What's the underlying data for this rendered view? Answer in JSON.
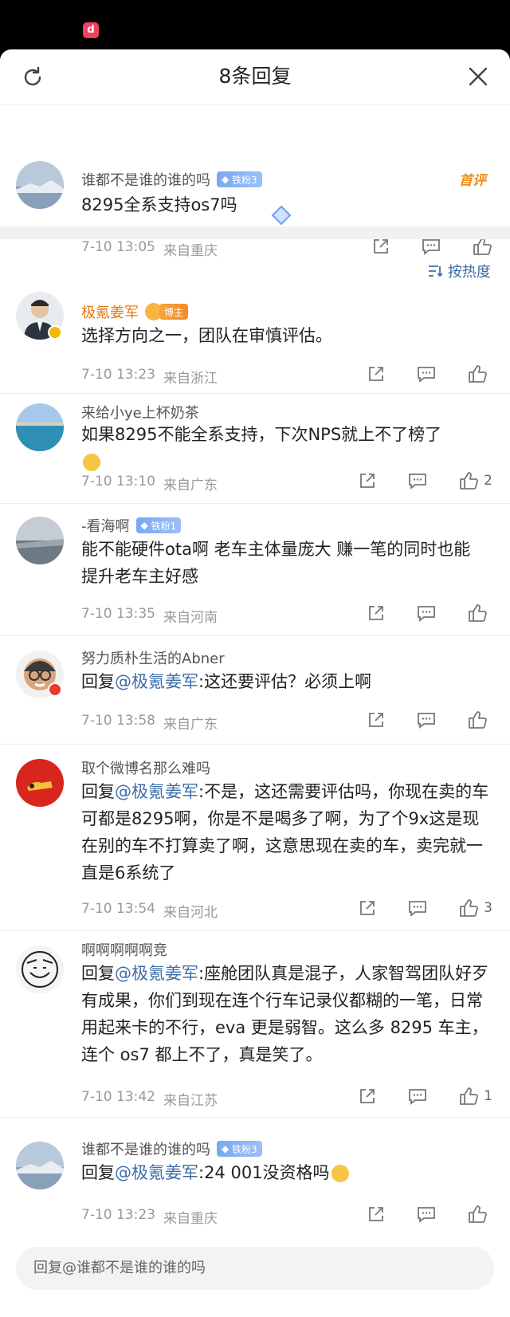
{
  "header": {
    "title": "8条回复"
  },
  "root": {
    "user": "谁都不是谁的谁的吗",
    "badge": "铁粉3",
    "text": "8295全系支持os7吗",
    "time": "7-10 13:05",
    "location": "来自重庆",
    "first_label": "首评"
  },
  "sort": {
    "label": "按热度"
  },
  "replies": [
    {
      "user": "极氪姜军",
      "badge": "博主",
      "text": "选择方向之一，团队在审慎评估。",
      "time": "7-10 13:23",
      "location": "来自浙江",
      "likes": ""
    },
    {
      "user": "来给小ye上杯奶茶",
      "text": "如果8295不能全系支持，下次NPS就上不了榜了",
      "time": "7-10 13:10",
      "location": "来自广东",
      "likes": "2"
    },
    {
      "user": "-看海啊",
      "badge": "铁粉1",
      "text": "能不能硬件ota啊 老车主体量庞大 赚一笔的同时也能提升老车主好感",
      "time": "7-10 13:35",
      "location": "来自河南",
      "likes": ""
    },
    {
      "user": "努力质朴生活的Abner",
      "prefix": "回复",
      "mention": "@极氪姜军",
      "text": ":这还要评估？必须上啊",
      "time": "7-10 13:58",
      "location": "来自广东",
      "likes": ""
    },
    {
      "user": "取个微博名那么难吗",
      "prefix": "回复",
      "mention": "@极氪姜军",
      "text": ":不是，这还需要评估吗，你现在卖的车可都是8295啊，你是不是喝多了啊，为了个9x这是现在别的车不打算卖了啊，这意思现在卖的车，卖完就一直是6系统了",
      "time": "7-10 13:54",
      "location": "来自河北",
      "likes": "3"
    },
    {
      "user": "啊啊啊啊啊竞",
      "prefix": "回复",
      "mention": "@极氪姜军",
      "text": ":座舱团队真是混子，人家智驾团队好歹有成果，你们到现在连个行车记录仪都糊的一笔，日常用起来卡的不行，eva 更是弱智。这么多 8295 车主，连个 os7 都上不了，真是笑了。",
      "time": "7-10 13:42",
      "location": "来自江苏",
      "likes": "1"
    },
    {
      "user": "谁都不是谁的谁的吗",
      "badge": "铁粉3",
      "prefix": "回复",
      "mention": "@极氪姜军",
      "text": ":24 001没资格吗",
      "time": "7-10 13:23",
      "location": "来自重庆",
      "likes": ""
    }
  ],
  "input": {
    "placeholder": "回复@谁都不是谁的谁的吗"
  }
}
